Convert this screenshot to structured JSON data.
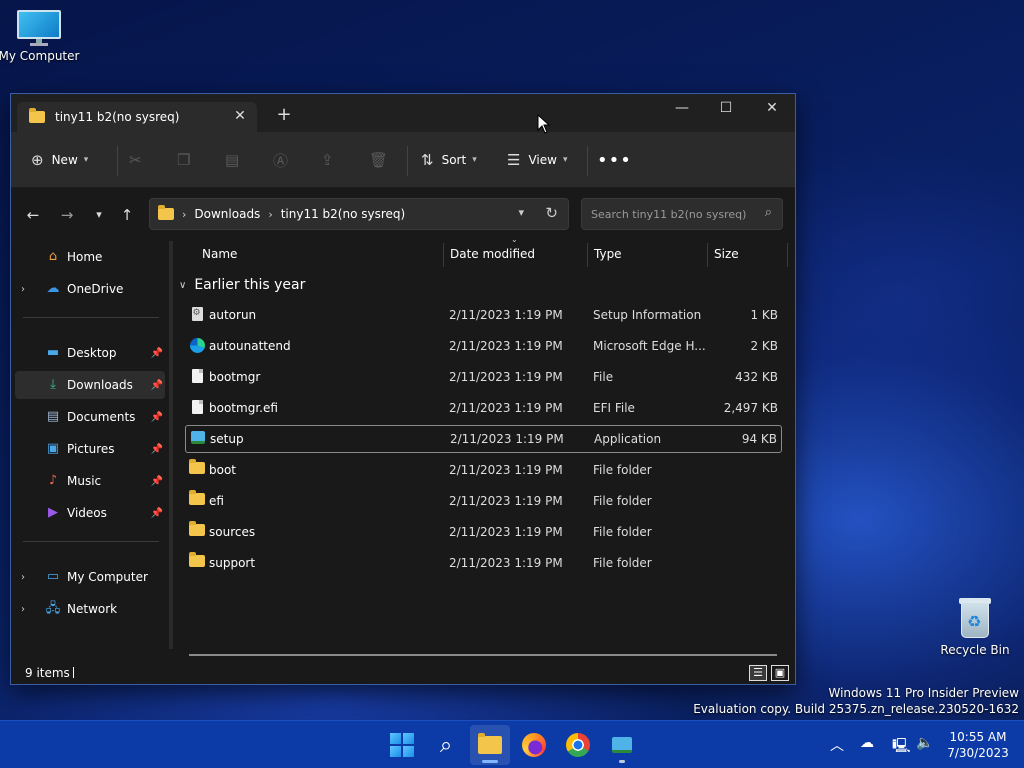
{
  "desktop": {
    "icons": [
      {
        "label": "My Computer"
      },
      {
        "label": "Recycle Bin"
      }
    ],
    "watermark": {
      "line1": "Windows 11 Pro Insider Preview",
      "line2": "Evaluation copy. Build 25375.zn_release.230520-1632"
    }
  },
  "window": {
    "tab_title": "tiny11 b2(no sysreq)",
    "new_tab": "+",
    "controls": {
      "minimize": "—",
      "maximize": "☐",
      "close": "✕"
    }
  },
  "toolbar": {
    "new_label": "New",
    "sort_label": "Sort",
    "view_label": "View",
    "more_label": "•••"
  },
  "address": {
    "crumbs": [
      "Downloads",
      "tiny11 b2(no sysreq)"
    ],
    "search_placeholder": "Search tiny11 b2(no sysreq)"
  },
  "nav": {
    "items": [
      {
        "label": "Home",
        "icon": "home-icon"
      },
      {
        "label": "OneDrive",
        "icon": "cloud-icon"
      },
      {
        "label": "Desktop",
        "icon": "desktop-icon",
        "pinned": true
      },
      {
        "label": "Downloads",
        "icon": "download-icon",
        "pinned": true,
        "selected": true
      },
      {
        "label": "Documents",
        "icon": "document-icon",
        "pinned": true
      },
      {
        "label": "Pictures",
        "icon": "picture-icon",
        "pinned": true
      },
      {
        "label": "Music",
        "icon": "music-icon",
        "pinned": true
      },
      {
        "label": "Videos",
        "icon": "video-icon",
        "pinned": true
      },
      {
        "label": "My Computer",
        "icon": "computer-icon"
      },
      {
        "label": "Network",
        "icon": "network-icon"
      }
    ]
  },
  "files": {
    "columns": [
      "Name",
      "Date modified",
      "Type",
      "Size"
    ],
    "group": "Earlier this year",
    "rows": [
      {
        "name": "autorun",
        "date": "2/11/2023 1:19 PM",
        "type": "Setup Information",
        "size": "1 KB",
        "icon": "setup-info-icon"
      },
      {
        "name": "autounattend",
        "date": "2/11/2023 1:19 PM",
        "type": "Microsoft Edge H...",
        "size": "2 KB",
        "icon": "edge-icon"
      },
      {
        "name": "bootmgr",
        "date": "2/11/2023 1:19 PM",
        "type": "File",
        "size": "432 KB",
        "icon": "file-icon"
      },
      {
        "name": "bootmgr.efi",
        "date": "2/11/2023 1:19 PM",
        "type": "EFI File",
        "size": "2,497 KB",
        "icon": "file-icon"
      },
      {
        "name": "setup",
        "date": "2/11/2023 1:19 PM",
        "type": "Application",
        "size": "94 KB",
        "icon": "application-icon"
      },
      {
        "name": "boot",
        "date": "2/11/2023 1:19 PM",
        "type": "File folder",
        "size": "",
        "icon": "folder-icon"
      },
      {
        "name": "efi",
        "date": "2/11/2023 1:19 PM",
        "type": "File folder",
        "size": "",
        "icon": "folder-icon"
      },
      {
        "name": "sources",
        "date": "2/11/2023 1:19 PM",
        "type": "File folder",
        "size": "",
        "icon": "folder-icon"
      },
      {
        "name": "support",
        "date": "2/11/2023 1:19 PM",
        "type": "File folder",
        "size": "",
        "icon": "folder-icon"
      }
    ]
  },
  "status": {
    "item_count": "9 items"
  },
  "taskbar": {
    "apps": [
      "start",
      "search",
      "file-explorer",
      "firefox",
      "chrome",
      "setup"
    ],
    "clock_time": "10:55 AM",
    "clock_date": "7/30/2023"
  }
}
